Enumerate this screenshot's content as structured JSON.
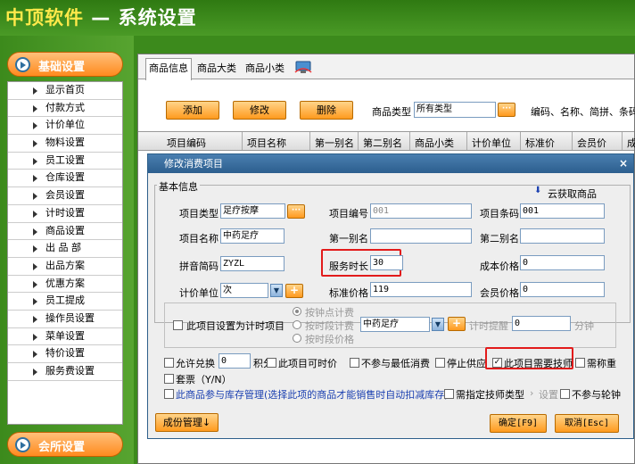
{
  "app": {
    "brand": "中顶软件",
    "title": " — 系统设置"
  },
  "sidebar": {
    "section_basic": "基础设置",
    "section_club": "会所设置",
    "items": [
      "显示首页",
      "付款方式",
      "计价单位",
      "物料设置",
      "员工设置",
      "仓库设置",
      "会员设置",
      "计时设置",
      "商品设置",
      "出 品 部",
      "出品方案",
      "优惠方案",
      "员工提成",
      "操作员设置",
      "菜单设置",
      "特价设置",
      "服务费设置"
    ]
  },
  "tabs": [
    "商品信息",
    "商品大类",
    "商品小类"
  ],
  "toolbar": {
    "add": "添加",
    "edit": "修改",
    "delete": "删除",
    "type_label": "商品类型",
    "type_value": "所有类型",
    "dots": "···",
    "search_hint": "编码、名称、简拼、条码"
  },
  "grid": {
    "headers": [
      "项目编码",
      "项目名称",
      "第一别名",
      "第二别名",
      "商品小类",
      "计价单位",
      "标准价",
      "会员价",
      "成"
    ]
  },
  "dialog": {
    "title": "修改消费项目",
    "group_title": "基本信息",
    "cloud_link": "云获取商品",
    "fields": {
      "item_type_label": "项目类型",
      "item_type_value": "足疗按摩",
      "item_code_label": "项目编号",
      "item_code_value": "001",
      "barcode_label": "项目条码",
      "barcode_value": "001",
      "item_name_label": "项目名称",
      "item_name_value": "中药足疗",
      "alias1_label": "第一别名",
      "alias1_value": "",
      "alias2_label": "第二别名",
      "alias2_value": "",
      "pinyin_label": "拼音简码",
      "pinyin_value": "ZYZL",
      "duration_label": "服务时长",
      "duration_value": "30",
      "cost_label": "成本价格",
      "cost_value": "0",
      "unit_label": "计价单位",
      "unit_value": "次",
      "std_price_label": "标准价格",
      "std_price_value": "119",
      "member_price_label": "会员价格",
      "member_price_value": "0"
    },
    "timing": {
      "checkbox_label": "此项目设置为计时项目",
      "radio1": "按钟点计费",
      "radio2": "按时段计费",
      "radio3": "按时段价格",
      "project_value": "中药足疗",
      "remind_label": "计时提醒",
      "remind_value": "0",
      "minute_unit": "分钟"
    },
    "options": {
      "allow_exchange": "允许兑换",
      "exchange_value": "0",
      "points": "积分",
      "allow_timed": "此项目可时价",
      "no_min_spend": "不参与最低消费",
      "stop_supply": "停止供应",
      "need_tech": "此项目需要技师",
      "need_tech_checked": "✓",
      "need_weigh": "需称重",
      "invoice": "套票（Y/N）",
      "inventory": "此商品参与库存管理(选择此项的商品才能销售时自动扣减库存)",
      "tech_type": "需指定技师类型",
      "settings": "设置",
      "no_rotate": "不参与轮钟"
    },
    "buttons": {
      "component": "成份管理↓",
      "ok": "确定[F9]",
      "cancel": "取消[Esc]",
      "add_plus": "+"
    }
  }
}
